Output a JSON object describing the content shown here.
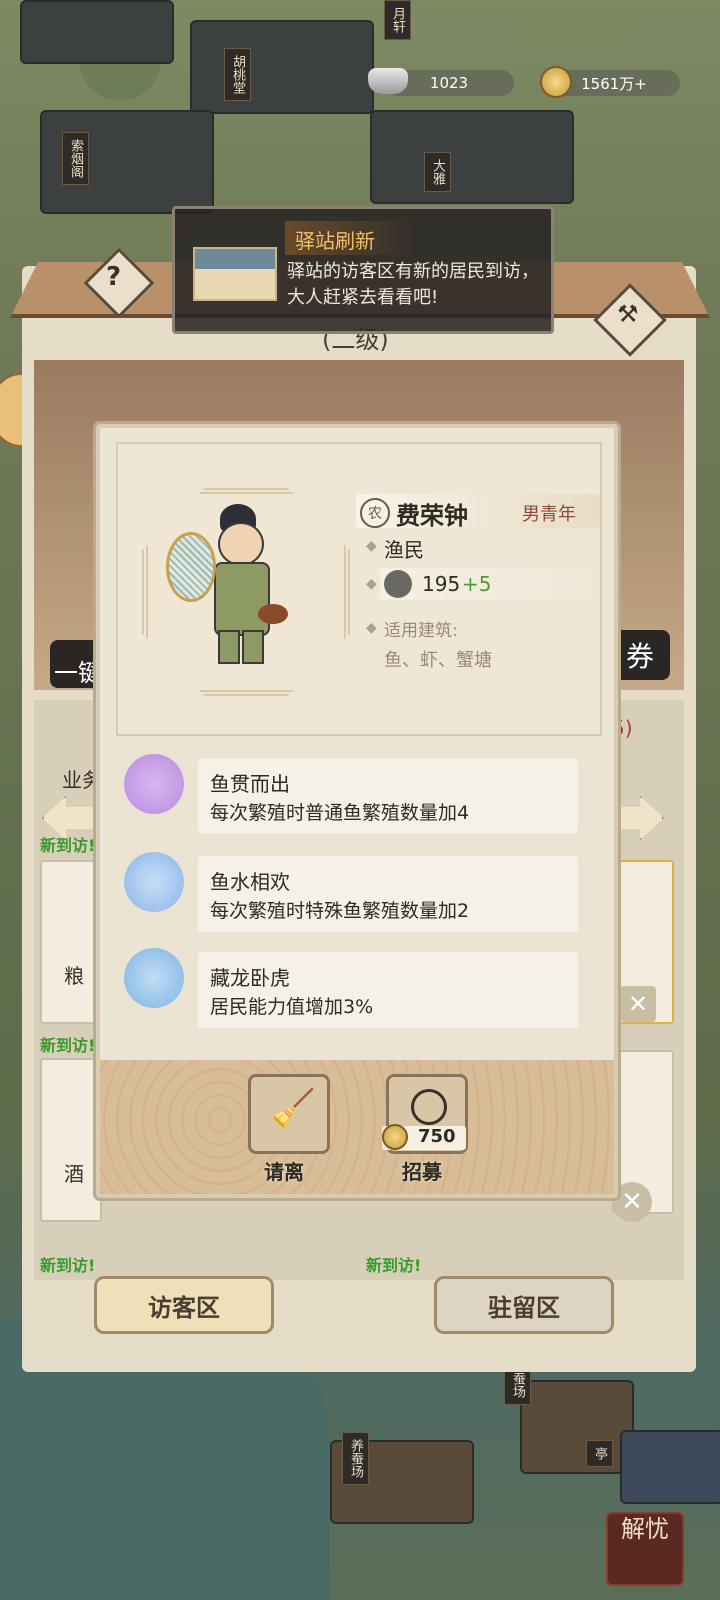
{
  "currency": {
    "silver": "1023",
    "gold": "1561万+"
  },
  "town_labels": [
    "胡桃堂",
    "索烟阁",
    "大雅",
    "月轩",
    "养蚕场",
    "养蚕场",
    "亭"
  ],
  "notification": {
    "title": "驿站刷新",
    "message": "驿站的访客区有新的居民到访，大人赶紧去看看吧!"
  },
  "panel": {
    "level": "(二级)",
    "behind_texts": {
      "left_btn": "一键",
      "right_btn": "券",
      "label_a": "业务",
      "label_b": "粮",
      "label_c": "酒",
      "count": "5)"
    },
    "new_arrival": "新到访!"
  },
  "resident": {
    "class_badge": "农",
    "name": "费荣钟",
    "tag": "男青年",
    "occupation": "渔民",
    "ability_base": "195",
    "ability_bonus": "+5",
    "buildings_label": "适用建筑:",
    "buildings": "鱼、虾、蟹塘"
  },
  "traits": [
    {
      "title": "鱼贯而出",
      "desc": "每次繁殖时普通鱼繁殖数量加4",
      "color": "#b88be0"
    },
    {
      "title": "鱼水相欢",
      "desc": "每次繁殖时特殊鱼繁殖数量加2",
      "color": "#8ab6ea"
    },
    {
      "title": "藏龙卧虎",
      "desc": "居民能力值增加3%",
      "color": "#7fb4e4"
    }
  ],
  "actions": {
    "dismiss": "请离",
    "recruit": "招募",
    "recruit_cost": "750"
  },
  "tabs": {
    "visitor": "访客区",
    "stay": "驻留区"
  },
  "corner_stamp": "解忧",
  "colors": {
    "accent_green": "#3a9b2a",
    "bonus_green": "#4a9a3a"
  }
}
